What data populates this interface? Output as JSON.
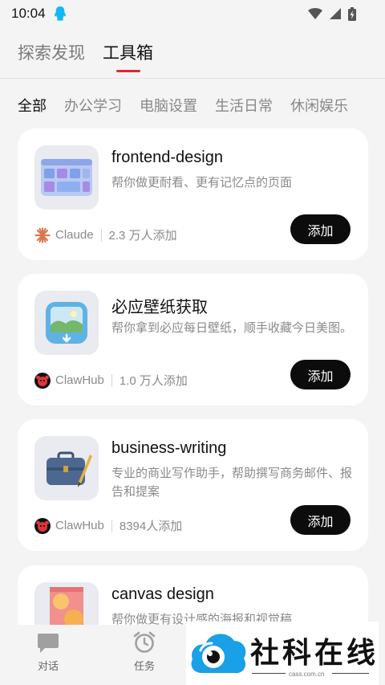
{
  "status": {
    "time": "10:04"
  },
  "top_tabs": [
    {
      "label": "探索发现",
      "active": false
    },
    {
      "label": "工具箱",
      "active": true
    }
  ],
  "categories": [
    "全部",
    "办公学习",
    "电脑设置",
    "生活日常",
    "休闲娱乐"
  ],
  "cards": [
    {
      "title": "frontend-design",
      "desc": "帮你做更耐看、更有记忆点的页面",
      "source": "Claude",
      "adds": "2.3 万人添加",
      "button": "添加",
      "icon": "ui-mockup-icon"
    },
    {
      "title": "必应壁纸获取",
      "desc": "帮你拿到必应每日壁纸，顺手收藏今日美图。",
      "source": "ClawHub",
      "adds": "1.0 万人添加",
      "button": "添加",
      "icon": "wallpaper-download-icon"
    },
    {
      "title": "business-writing",
      "desc": "专业的商业写作助手，帮助撰写商务邮件、报告和提案",
      "source": "ClawHub",
      "adds": "8394人添加",
      "button": "添加",
      "icon": "briefcase-pen-icon"
    },
    {
      "title": "canvas design",
      "desc": "帮你做更有设计感的海报和视觉稿",
      "icon": "poster-icon"
    }
  ],
  "bottom_nav": [
    {
      "label": "对话",
      "icon": "chat-icon"
    },
    {
      "label": "任务",
      "icon": "alarm-clock-icon"
    }
  ],
  "watermark": {
    "text": "社科在线",
    "url": "cass.com.cn"
  },
  "colors": {
    "accent": "#e12a2a",
    "button": "#0c0c0c",
    "background": "#f4f4f4"
  }
}
